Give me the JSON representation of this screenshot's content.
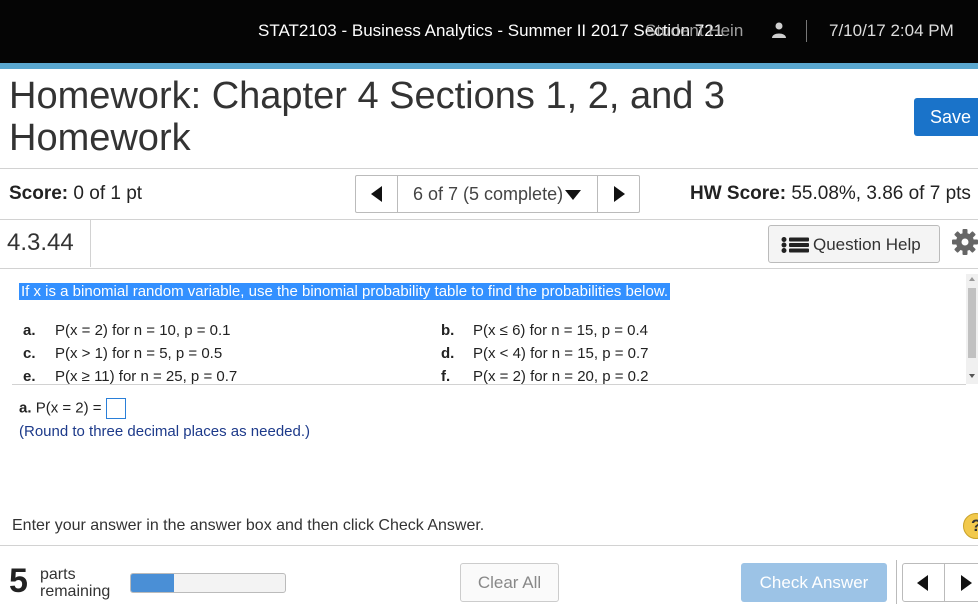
{
  "header": {
    "course": "STAT2103 - Business Analytics - Summer II 2017 Section 721",
    "user": "Student Hein",
    "datetime": "7/10/17 2:04 PM",
    "user_icon": "person-icon"
  },
  "title": "Homework: Chapter 4 Sections 1, 2, and 3 Homework",
  "toolbar": {
    "save_label": "Save"
  },
  "score": {
    "label": "Score:",
    "value": "0 of 1 pt"
  },
  "question_nav": {
    "position_label": "6 of 7 (5 complete)"
  },
  "hw_score": {
    "label": "HW Score:",
    "value": "55.08%, 3.86 of 7 pts"
  },
  "question": {
    "number": "4.3.44",
    "help_label": "Question Help",
    "prompt": "If x is a binomial random variable, use the binomial probability table to find the probabilities below.",
    "parts": [
      {
        "letter": "a.",
        "text": "P(x = 2) for n = 10, p = 0.1"
      },
      {
        "letter": "b.",
        "text": "P(x ≤ 6) for n = 15, p = 0.4"
      },
      {
        "letter": "c.",
        "text": "P(x > 1) for n = 5, p = 0.5"
      },
      {
        "letter": "d.",
        "text": "P(x < 4) for n = 15, p = 0.7"
      },
      {
        "letter": "e.",
        "text": "P(x ≥ 11) for n = 25, p = 0.7"
      },
      {
        "letter": "f.",
        "text": "P(x = 2) for n = 20, p = 0.2"
      }
    ]
  },
  "answer": {
    "letter": "a.",
    "expression": "P(x = 2) =",
    "note": "(Round to three decimal places as needed.)"
  },
  "instruction": "Enter your answer in the answer box and then click Check Answer.",
  "bottom": {
    "parts_count": "5",
    "parts_label_1": "parts",
    "parts_label_2": "remaining",
    "progress_fraction": 0.28,
    "clear_label": "Clear All",
    "check_label": "Check Answer"
  },
  "colors": {
    "topbar": "#050505",
    "accent": "#5aa7cf",
    "save": "#1a73c9",
    "selection": "#3390ff",
    "check_disabled": "#9cc3e6",
    "progress": "#4a8fd6"
  }
}
